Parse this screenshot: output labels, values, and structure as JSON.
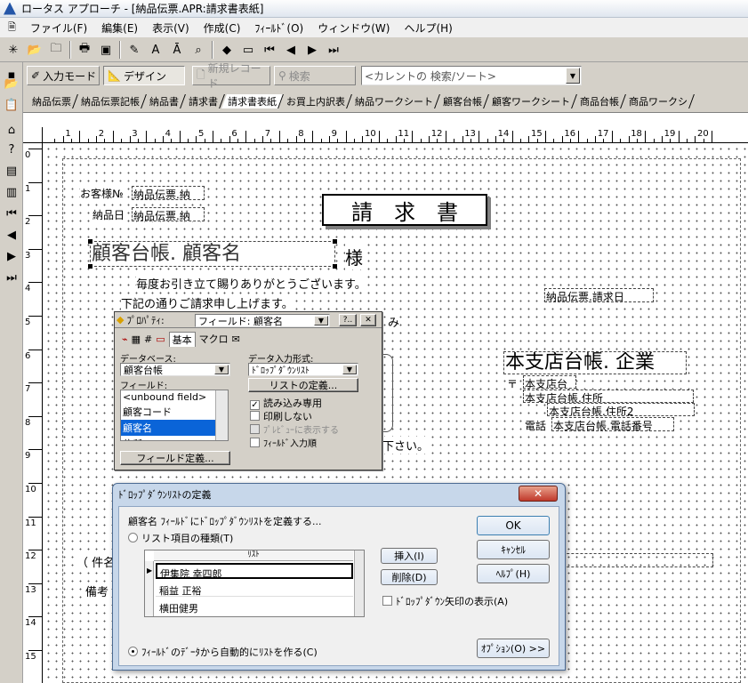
{
  "window": {
    "title": "ロータス アプローチ - [納品伝票.APR:請求書表紙]"
  },
  "menu": [
    "ファイル(F)",
    "編集(E)",
    "表示(V)",
    "作成(C)",
    "ﾌｨｰﾙﾄﾞ(O)",
    "ウィンドウ(W)",
    "ヘルプ(H)"
  ],
  "toolbar2": {
    "input_mode": "入力モード",
    "design": "デザイン",
    "new_record": "新規レコード",
    "search": "検索",
    "search_combo": "<カレントの 検索/ソート>"
  },
  "tabs": [
    "納品伝票",
    "納品伝票記帳",
    "納品書",
    "請求書",
    "請求書表紙",
    "お買上内訳表",
    "納品ワークシート",
    "顧客台帳",
    "顧客ワークシート",
    "商品台帳",
    "商品ワークシ"
  ],
  "active_tab": "請求書表紙",
  "ruler": {
    "h": [
      "1",
      "2",
      "3",
      "4",
      "5",
      "6",
      "7",
      "8",
      "9",
      "10",
      "11",
      "12",
      "13",
      "14",
      "15",
      "16",
      "17",
      "18",
      "19",
      "20"
    ],
    "v": [
      "0",
      "1",
      "2",
      "3",
      "4",
      "5",
      "6",
      "7",
      "8",
      "9",
      "10",
      "11",
      "12",
      "13",
      "14",
      "15"
    ]
  },
  "form": {
    "customer_no_label": "お客様№",
    "customer_no_field": "納品伝票.納",
    "delivery_date_label": "納品日",
    "delivery_date_field": "納品伝票.納",
    "title": "請　求　書",
    "customer_name_field": "顧客台帳. 顧客名",
    "sama": "様",
    "greeting1": "毎度お引き立て賜りありがとうございます。",
    "greeting2": "下記の通りご請求申し上げます。",
    "mi": "み",
    "please": "下さい。",
    "invoice_field": "納品伝票.請求日",
    "company_field": "本支店台帳. 企業",
    "postal": "〒",
    "branch1": "本支店台",
    "address1": "本支店台帳.住所",
    "address2": "本支店台帳.住所2",
    "tel_label": "電話",
    "tel_field": "本支店台帳.電話番号",
    "subject": "（ 件名",
    "remarks": "備考"
  },
  "properties": {
    "title": "ﾌﾟﾛﾊﾟﾃｨ:",
    "object_combo": "フィールド: 顧客名",
    "help_btn": "?..",
    "close_btn": "✕",
    "tabs": [
      "基本",
      "マクロ"
    ],
    "database_label": "データベース:",
    "database_value": "顧客台帳",
    "input_format_label": "データ入力形式:",
    "input_format_value": "ﾄﾞﾛｯﾌﾟﾀﾞｳﾝﾘｽﾄ",
    "field_label": "フィールド:",
    "fields": [
      "<unbound field>",
      "顧客コード",
      "顧客名",
      "住所"
    ],
    "list_def_btn": "リストの定義...",
    "read_only": "読み込み専用",
    "no_print": "印刷しない",
    "preview_show": "ﾌﾟﾚﾋﾞｭｰに表示する",
    "input_order": "ﾌｨｰﾙﾄﾞ入力順",
    "field_def_btn": "フィールド定義..."
  },
  "dropdown": {
    "title": "ﾄﾞﾛｯﾌﾟﾀﾞｳﾝﾘｽﾄの定義",
    "instruction": "顧客名 ﾌｨｰﾙﾄﾞにﾄﾞﾛｯﾌﾟﾀﾞｳﾝﾘｽﾄを定義する...",
    "radio_list": "リスト項目の種類(T)",
    "list_header": "ﾘｽﾄ",
    "items": [
      "伊集院 幸四郎",
      "稲益 正裕",
      "横田健男"
    ],
    "insert": "挿入(I)",
    "delete": "削除(D)",
    "show_arrow": "ﾄﾞﾛｯﾌﾟﾀﾞｳﾝ矢印の表示(A)",
    "radio_field": "ﾌｨｰﾙﾄﾞのﾃﾞｰﾀから自動的にﾘｽﾄを作る(C)",
    "ok": "OK",
    "cancel": "ｷｬﾝｾﾙ",
    "help": "ﾍﾙﾌﾟ(H)",
    "options": "ｵﾌﾟｼｮﾝ(O) >>",
    "close": "✕"
  }
}
